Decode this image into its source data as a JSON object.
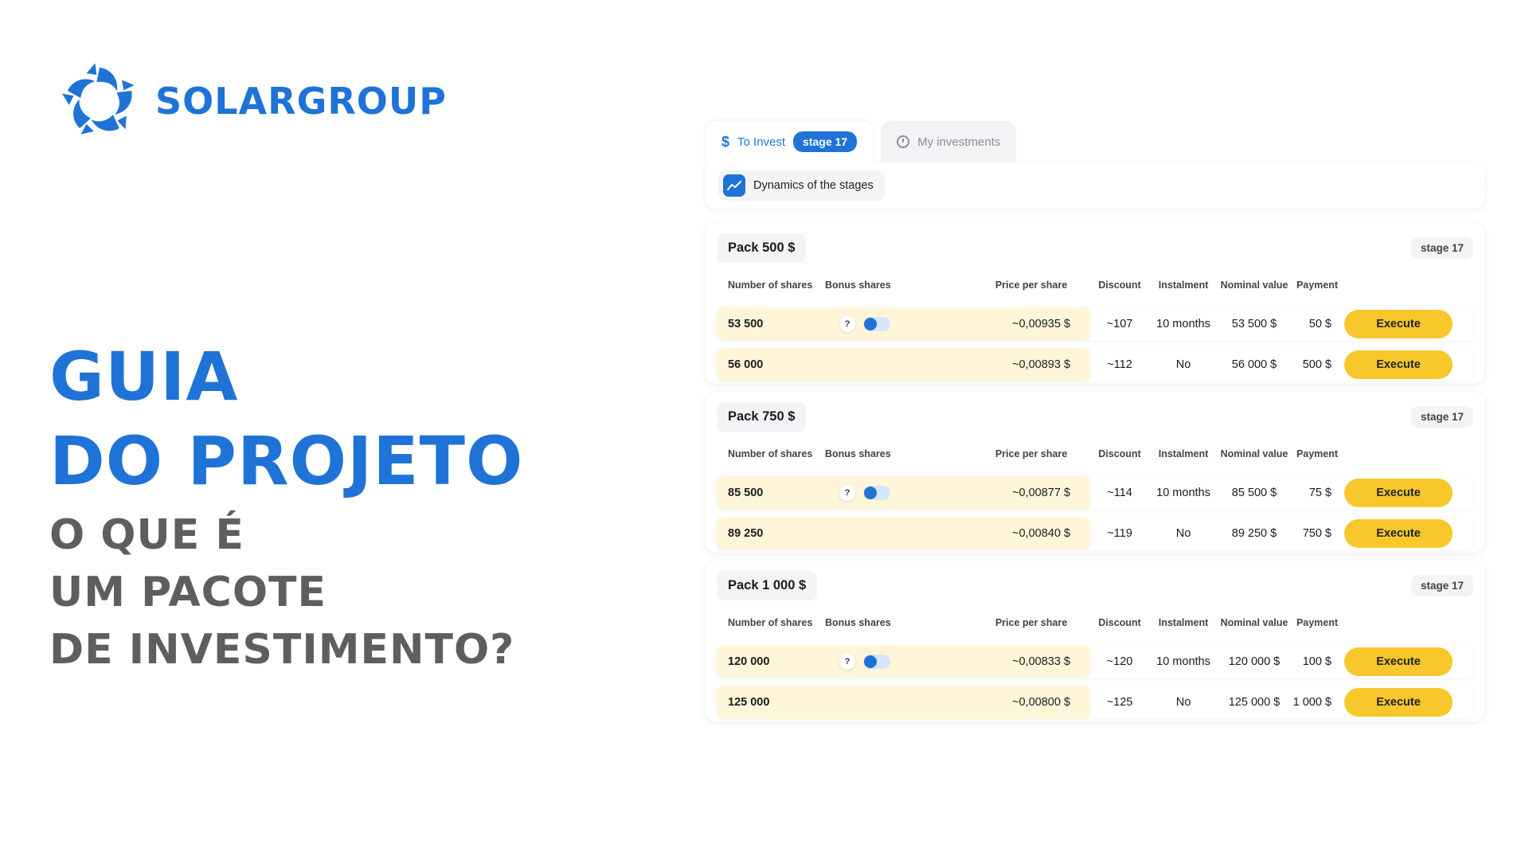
{
  "brand": {
    "name": "SOLARGROUP",
    "color": "#1f73d6",
    "icon": "sun-petal-logo-icon"
  },
  "hero": {
    "line1": "GUIA",
    "line2": "DO PROJETO",
    "line3": "O QUE É",
    "line4": "UM PACOTE",
    "line5": "DE INVESTIMENTO?"
  },
  "tabs": {
    "invest": {
      "icon": "dollar-icon",
      "label": "To Invest",
      "badge": "stage 17"
    },
    "my": {
      "icon": "clock-icon",
      "label": "My investments"
    }
  },
  "dynamics": {
    "icon": "trend-chart-icon",
    "label": "Dynamics of the stages"
  },
  "columns": {
    "shares": "Number of shares",
    "bonus": "Bonus shares",
    "price": "Price per share",
    "discount": "Discount",
    "instalment": "Instalment",
    "nominal": "Nominal value",
    "payment": "Payment"
  },
  "packs": [
    {
      "title": "Pack 500 $",
      "stage": "stage 17",
      "rows": [
        {
          "shares": "53 500",
          "price": "~0,00935 $",
          "discount": "~107",
          "instalment": "10 months",
          "nominal": "53 500 $",
          "payment": "50 $",
          "action": "Execute"
        },
        {
          "shares": "56 000",
          "price": "~0,00893 $",
          "discount": "~112",
          "instalment": "No",
          "nominal": "56 000 $",
          "payment": "500 $",
          "action": "Execute"
        }
      ]
    },
    {
      "title": "Pack 750 $",
      "stage": "stage 17",
      "rows": [
        {
          "shares": "85 500",
          "price": "~0,00877 $",
          "discount": "~114",
          "instalment": "10 months",
          "nominal": "85 500 $",
          "payment": "75 $",
          "action": "Execute"
        },
        {
          "shares": "89 250",
          "price": "~0,00840 $",
          "discount": "~119",
          "instalment": "No",
          "nominal": "89 250 $",
          "payment": "750 $",
          "action": "Execute"
        }
      ]
    },
    {
      "title": "Pack 1 000 $",
      "stage": "stage 17",
      "rows": [
        {
          "shares": "120 000",
          "price": "~0,00833 $",
          "discount": "~120",
          "instalment": "10 months",
          "nominal": "120 000 $",
          "payment": "100 $",
          "action": "Execute"
        },
        {
          "shares": "125 000",
          "price": "~0,00800 $",
          "discount": "~125",
          "instalment": "No",
          "nominal": "125 000 $",
          "payment": "1 000 $",
          "action": "Execute"
        }
      ]
    }
  ],
  "colors": {
    "accent_blue": "#1f73d6",
    "execute_yellow": "#f7c72c",
    "row_highlight": "#fff6d9",
    "hero_gray": "#5e5e5e"
  }
}
